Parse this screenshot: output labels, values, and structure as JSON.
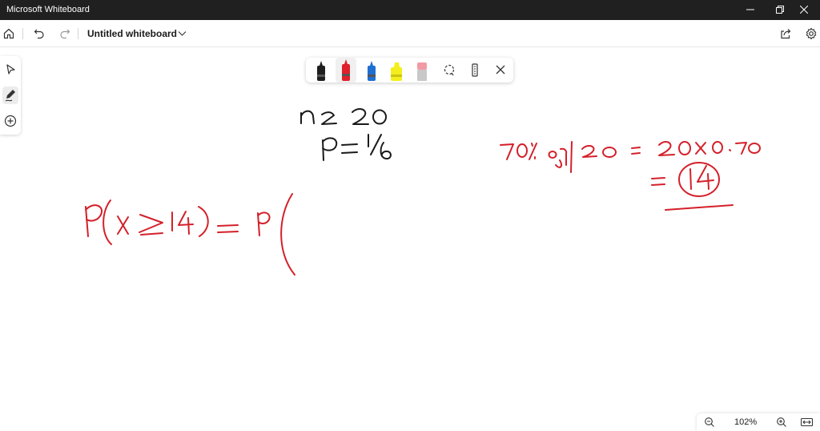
{
  "window": {
    "title": "Microsoft Whiteboard",
    "controls": [
      "minimize-icon",
      "restore-icon",
      "close-icon"
    ]
  },
  "appbar": {
    "document_title": "Untitled whiteboard",
    "left_icons": [
      "home-icon",
      "undo-icon",
      "redo-icon",
      "chevron-down-icon"
    ],
    "right_icons": [
      "share-icon",
      "gear-icon"
    ]
  },
  "left_rail": {
    "tools": [
      "select-icon",
      "pen-icon",
      "add-icon"
    ],
    "active": "pen-icon"
  },
  "pen_tray": {
    "tools": [
      {
        "name": "black-pen",
        "color": "#1f1f1f"
      },
      {
        "name": "red-pen",
        "color": "#e0202a"
      },
      {
        "name": "blue-pen",
        "color": "#1f6fd1"
      },
      {
        "name": "yellow-highlighter",
        "color": "#f4ee1c"
      },
      {
        "name": "pink-eraser",
        "color": "#f29aa4"
      }
    ],
    "active": "red-pen",
    "extra_icons": [
      "lasso-select-icon",
      "ruler-icon",
      "close-icon"
    ]
  },
  "canvas": {
    "ink_colors": {
      "black": "#1a1a1a",
      "red": "#d4202a"
    }
  },
  "zoom": {
    "label": "102%",
    "icons": [
      "zoom-out-icon",
      "zoom-in-icon",
      "fit-width-icon"
    ]
  }
}
